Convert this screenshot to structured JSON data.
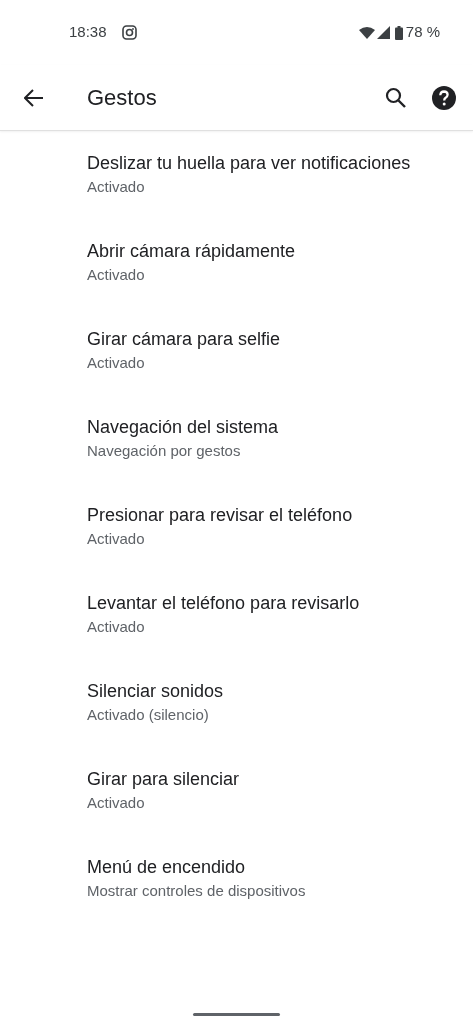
{
  "status_bar": {
    "time": "18:38",
    "battery": "78 %"
  },
  "toolbar": {
    "title": "Gestos"
  },
  "items": [
    {
      "title": "Deslizar tu huella para ver notificaciones",
      "summary": "Activado"
    },
    {
      "title": "Abrir cámara rápidamente",
      "summary": "Activado"
    },
    {
      "title": "Girar cámara para selfie",
      "summary": "Activado"
    },
    {
      "title": "Navegación del sistema",
      "summary": "Navegación por gestos"
    },
    {
      "title": "Presionar para revisar el teléfono",
      "summary": "Activado"
    },
    {
      "title": "Levantar el teléfono para revisarlo",
      "summary": "Activado"
    },
    {
      "title": "Silenciar sonidos",
      "summary": "Activado (silencio)"
    },
    {
      "title": "Girar para silenciar",
      "summary": "Activado"
    },
    {
      "title": "Menú de encendido",
      "summary": "Mostrar controles de dispositivos"
    }
  ]
}
